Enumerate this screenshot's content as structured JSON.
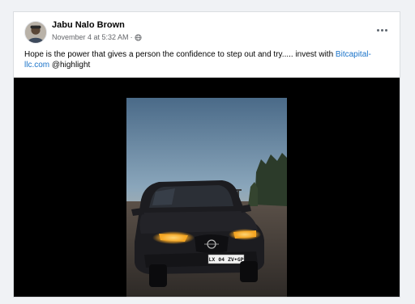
{
  "post": {
    "author": "Jabu Nalo Brown",
    "timestamp": "November 4 at 5:32 AM",
    "separator": "·",
    "privacy_icon": "globe-icon",
    "more_icon": "more-options-icon",
    "text_before_link": "Hope is the power that gives a person the confidence to step out and try..... invest with ",
    "link_text": "Bitcapital-llc.com",
    "text_after_link": " @highlight",
    "link_color": "#1a73c9"
  },
  "media": {
    "type": "video",
    "plate_text": "LX 04 ZV•GP"
  },
  "colors": {
    "page_background": "#f0f2f5",
    "card_background": "#ffffff",
    "media_background": "#000000",
    "headlight": "#f5a623"
  }
}
